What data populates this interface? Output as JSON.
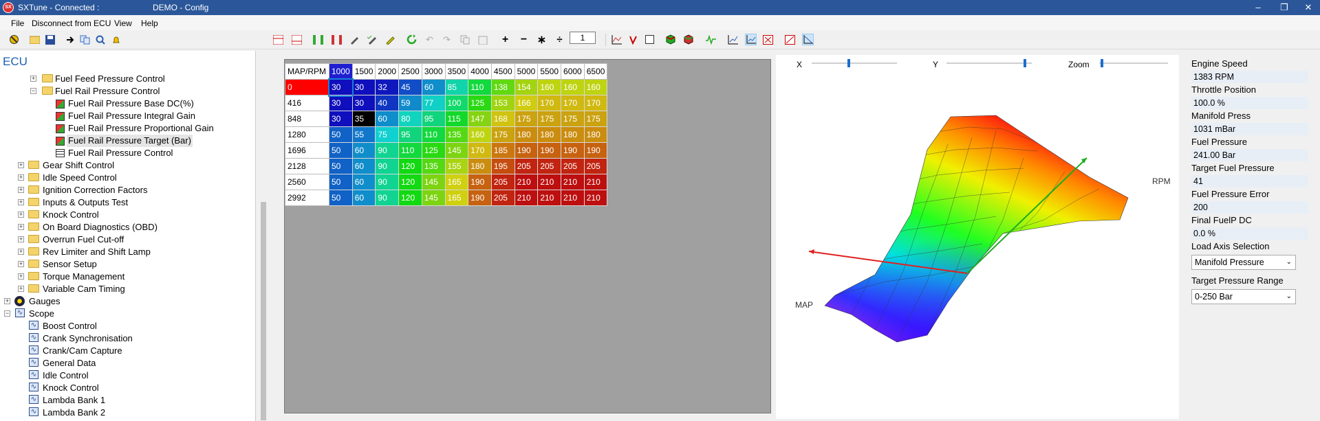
{
  "title": {
    "app": "SXTune - Connected :",
    "config": "DEMO - Config"
  },
  "window_buttons": {
    "minimize": "–",
    "restore": "❐",
    "close": "✕"
  },
  "menu": [
    "File",
    "Disconnect from ECU",
    "View",
    "Help"
  ],
  "toolbar": {
    "page_value": "1"
  },
  "tree": {
    "root": "ECU",
    "items": [
      {
        "label": "Fuel Feed Pressure Control"
      },
      {
        "label": "Fuel Rail Pressure Control"
      },
      {
        "label": "Fuel Rail Pressure Base DC(%)"
      },
      {
        "label": "Fuel Rail Pressure Integral Gain"
      },
      {
        "label": "Fuel Rail Pressure Proportional Gain"
      },
      {
        "label": "Fuel Rail Pressure Target (Bar)"
      },
      {
        "label": "Fuel Rail Pressure Control"
      },
      {
        "label": "Gear Shift Control"
      },
      {
        "label": "Idle Speed Control"
      },
      {
        "label": "Ignition Correction Factors"
      },
      {
        "label": "Inputs & Outputs Test"
      },
      {
        "label": "Knock Control"
      },
      {
        "label": "On Board Diagnostics (OBD)"
      },
      {
        "label": "Overrun Fuel Cut-off"
      },
      {
        "label": "Rev Limiter and Shift Lamp"
      },
      {
        "label": "Sensor Setup"
      },
      {
        "label": "Torque Management"
      },
      {
        "label": "Variable Cam Timing"
      },
      {
        "label": "Gauges"
      },
      {
        "label": "Scope"
      },
      {
        "label": "Boost Control"
      },
      {
        "label": "Crank Synchronisation"
      },
      {
        "label": "Crank/Cam Capture"
      },
      {
        "label": "General Data"
      },
      {
        "label": "Idle Control"
      },
      {
        "label": "Knock Control"
      },
      {
        "label": "Lambda Bank 1"
      },
      {
        "label": "Lambda Bank 2"
      }
    ]
  },
  "table": {
    "corner": "MAP/RPM",
    "columns": [
      "1000",
      "1500",
      "2000",
      "2500",
      "3000",
      "3500",
      "4000",
      "4500",
      "5000",
      "5500",
      "6000",
      "6500"
    ],
    "rows": [
      {
        "label": "0",
        "values": [
          "30",
          "30",
          "32",
          "45",
          "60",
          "85",
          "110",
          "138",
          "154",
          "160",
          "160",
          "160"
        ]
      },
      {
        "label": "416",
        "values": [
          "30",
          "30",
          "40",
          "59",
          "77",
          "100",
          "125",
          "153",
          "166",
          "170",
          "170",
          "170"
        ]
      },
      {
        "label": "848",
        "values": [
          "30",
          "35",
          "60",
          "80",
          "95",
          "115",
          "147",
          "168",
          "175",
          "175",
          "175",
          "175"
        ]
      },
      {
        "label": "1280",
        "values": [
          "50",
          "55",
          "75",
          "95",
          "110",
          "135",
          "160",
          "175",
          "180",
          "180",
          "180",
          "180"
        ]
      },
      {
        "label": "1696",
        "values": [
          "50",
          "60",
          "90",
          "110",
          "125",
          "145",
          "170",
          "185",
          "190",
          "190",
          "190",
          "190"
        ]
      },
      {
        "label": "2128",
        "values": [
          "50",
          "60",
          "90",
          "120",
          "135",
          "155",
          "180",
          "195",
          "205",
          "205",
          "205",
          "205"
        ]
      },
      {
        "label": "2560",
        "values": [
          "50",
          "60",
          "90",
          "120",
          "145",
          "165",
          "190",
          "205",
          "210",
          "210",
          "210",
          "210"
        ]
      },
      {
        "label": "2992",
        "values": [
          "50",
          "60",
          "90",
          "120",
          "145",
          "165",
          "190",
          "205",
          "210",
          "210",
          "210",
          "210"
        ]
      }
    ]
  },
  "graph": {
    "x_label": "X",
    "y_label": "Y",
    "zoom_label": "Zoom",
    "axis_map": "MAP",
    "axis_rpm": "RPM",
    "x_slider": 0.42,
    "y_slider": 0.9,
    "zoom_slider": 0.02
  },
  "gauges": [
    {
      "label": "Engine Speed",
      "value": "1383 RPM"
    },
    {
      "label": "Throttle Position",
      "value": "100.0 %"
    },
    {
      "label": "Manifold Press",
      "value": "1031 mBar"
    },
    {
      "label": "Fuel Pressure",
      "value": "241.00 Bar"
    },
    {
      "label": "Target Fuel Pressure",
      "value": "41"
    },
    {
      "label": "Fuel Pressure Error",
      "value": "200"
    },
    {
      "label": "Final FuelP DC",
      "value": "0.0 %"
    }
  ],
  "load_axis": {
    "label": "Load Axis Selection",
    "value": "Manifold Pressure"
  },
  "target_range": {
    "label": "Target Pressure Range",
    "value": "0-250 Bar"
  }
}
